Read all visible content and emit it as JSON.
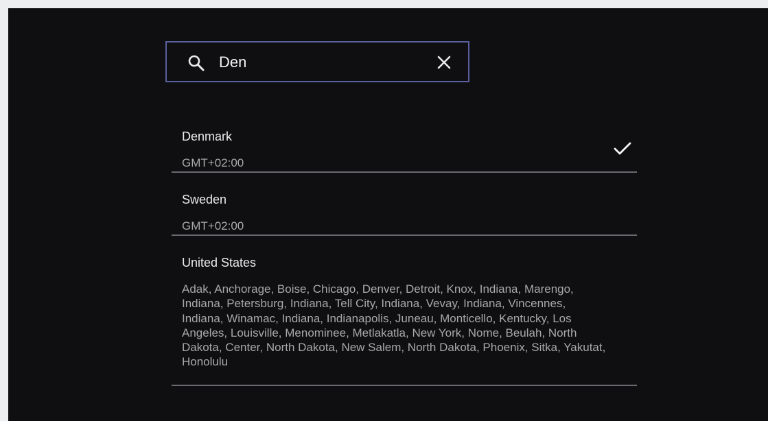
{
  "search": {
    "value": "Den",
    "search_icon": "search-icon",
    "clear_icon": "close-icon"
  },
  "results": [
    {
      "name": "Denmark",
      "detail": "GMT+02:00",
      "selected": true
    },
    {
      "name": "Sweden",
      "detail": "GMT+02:00",
      "selected": false
    },
    {
      "name": "United States",
      "detail": "Adak, Anchorage, Boise, Chicago, Denver, Detroit, Knox, Indiana, Marengo, Indiana, Petersburg, Indiana, Tell City, Indiana, Vevay, Indiana, Vincennes, Indiana, Winamac, Indiana, Indianapolis, Juneau, Monticello, Kentucky, Los Angeles, Louisville, Menominee, Metlakatla, New York, Nome, Beulah, North Dakota, Center, North Dakota, New Salem, North Dakota, Phoenix, Sitka, Yakutat, Honolulu",
      "selected": false
    }
  ],
  "colors": {
    "background": "#0f0f11",
    "frame": "#eceef0",
    "search_border": "#5a5f9e",
    "divider": "#6a6a6e",
    "text_primary": "#ececec",
    "text_secondary": "#a8a8a8"
  }
}
